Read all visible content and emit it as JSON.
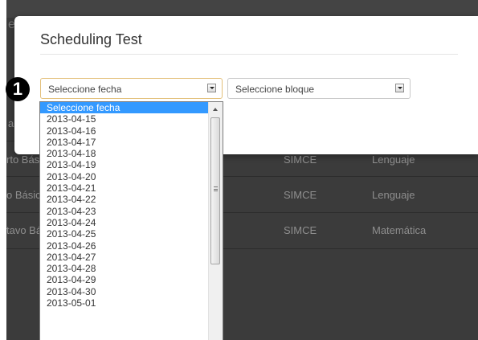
{
  "modal": {
    "title": "Scheduling Test"
  },
  "step_badge": "1",
  "date_select": {
    "selected": "Seleccione fecha"
  },
  "block_select": {
    "selected": "Seleccione bloque"
  },
  "date_options": [
    "Seleccione fecha",
    "2013-04-15",
    "2013-04-16",
    "2013-04-17",
    "2013-04-18",
    "2013-04-19",
    "2013-04-20",
    "2013-04-21",
    "2013-04-22",
    "2013-04-23",
    "2013-04-24",
    "2013-04-25",
    "2013-04-26",
    "2013-04-27",
    "2013-04-28",
    "2013-04-29",
    "2013-04-30",
    "2013-05-01"
  ],
  "background_table": {
    "rows": [
      {
        "course": "rto Bás",
        "type": "SIMCE",
        "subject": "Lenguaje"
      },
      {
        "course": "o Básic",
        "type": "SIMCE",
        "subject": "Lenguaje"
      },
      {
        "course": "tavo Bá",
        "type": "SIMCE",
        "subject": "Matemática"
      }
    ],
    "partial_left_1": "e",
    "partial_left_2": "a"
  }
}
